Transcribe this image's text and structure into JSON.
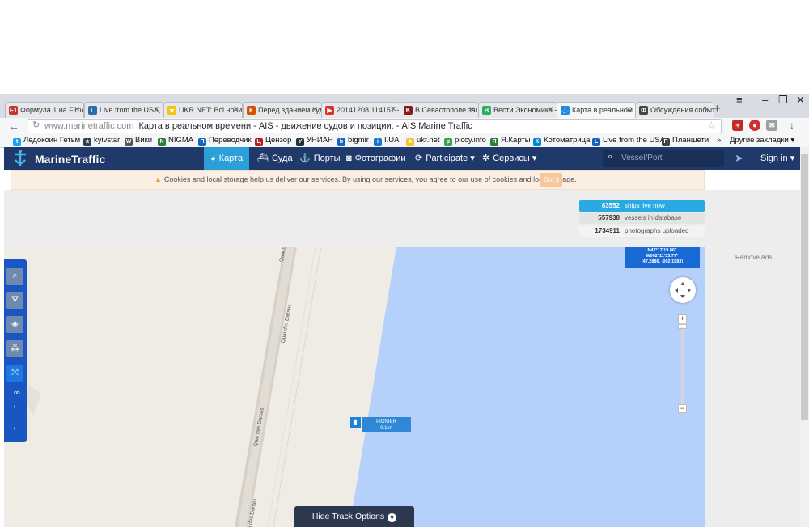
{
  "browser": {
    "tabs": [
      {
        "label": "Формула 1 на F1ne",
        "color": "#c0392b",
        "glyph": "F1"
      },
      {
        "label": "Live from the USA, ·",
        "color": "#2b6cb0",
        "glyph": "L"
      },
      {
        "label": "UKR.NET: Всі новин",
        "color": "#f1c40f",
        "glyph": "★"
      },
      {
        "label": "Перед зданием суд",
        "color": "#d35400",
        "glyph": "К"
      },
      {
        "label": "20141208 114157 - Y",
        "color": "#e52d27",
        "glyph": "▶"
      },
      {
        "label": "В Севастополе зац",
        "color": "#8b1a1a",
        "glyph": "K"
      },
      {
        "label": "Вести Экономика -",
        "color": "#27ae60",
        "glyph": "В"
      },
      {
        "label": "Карта в реальном в",
        "color": "#1e88e5",
        "glyph": "⚓"
      },
      {
        "label": "Обсуждения событ",
        "color": "#444444",
        "glyph": "Ф"
      }
    ],
    "new_tab": "+",
    "window": {
      "minimize": "–",
      "restore": "❐",
      "close": "✕",
      "menu": "≡"
    },
    "address": {
      "host": "www.marinetraffic.com",
      "title": "Карта в реальном времени - AIS - движение судов и позиции. - AIS Marine Traffic"
    },
    "bookmarks": [
      {
        "label": "Ледокоин Гетьм",
        "color": "#1da1f2",
        "glyph": "t"
      },
      {
        "label": "kyivstar",
        "color": "#2c3e50",
        "glyph": "★"
      },
      {
        "label": "Вики",
        "color": "#555555",
        "glyph": "W"
      },
      {
        "label": "NIGMA",
        "color": "#2e7d32",
        "glyph": "N"
      },
      {
        "label": "Переводчик",
        "color": "#1565c0",
        "glyph": "П"
      },
      {
        "label": "Цензор",
        "color": "#b71c1c",
        "glyph": "Ц"
      },
      {
        "label": "УНИАН",
        "color": "#263238",
        "glyph": "У"
      },
      {
        "label": "bigmir",
        "color": "#1565c0",
        "glyph": "b"
      },
      {
        "label": "I.UA",
        "color": "#1976d2",
        "glyph": "i"
      },
      {
        "label": "ukr.net",
        "color": "#fbc02d",
        "glyph": "★"
      },
      {
        "label": "piccy.info",
        "color": "#43a047",
        "glyph": "p"
      },
      {
        "label": "Я.Карты",
        "color": "#2e7d32",
        "glyph": "Я"
      },
      {
        "label": "Котоматрица",
        "color": "#0288d1",
        "glyph": "К"
      },
      {
        "label": "Live from the USA",
        "color": "#1565c0",
        "glyph": "L"
      },
      {
        "label": "Планшети",
        "color": "#424242",
        "glyph": "П"
      }
    ],
    "bookmarks_more": "»",
    "other_bookmarks": "Другие закладки ▾"
  },
  "header": {
    "brand": "MarineTraffic",
    "nav": [
      "Карта",
      "Суда",
      "Порты",
      "Фотографии",
      "Participate ▾",
      "Сервисы ▾"
    ],
    "search_placeholder": "Vessel/Port",
    "signin": "Sign in ▾"
  },
  "cookie": {
    "text": "Cookies and local storage help us deliver our services. By using our services, you agree to",
    "link": "our use of cookies and local storage",
    "end": ".",
    "button": "Got it"
  },
  "stats": [
    {
      "value": "63552",
      "label": "ships live now"
    },
    {
      "value": "557938",
      "label": "vessels in database"
    },
    {
      "value": "1734911",
      "label": "photographs uploaded"
    }
  ],
  "remove_ads": "Remove Ads",
  "map": {
    "coords": [
      "N47°17'19.86\"",
      "W002°11'33.77\"",
      "(47.2886, -002.1983)"
    ],
    "road_label": "Quai des Darses",
    "vessel": {
      "name": "PIONIER",
      "distance": "0.1kn"
    },
    "zoom_in": "+",
    "zoom_out": "−",
    "infinity": "∞",
    "hide_track": "Hide Track Options"
  },
  "colors": {
    "nav_bg": "#20396b",
    "nav_active": "#2a9fd8",
    "sea": "#b5d0fa",
    "land": "#efece6",
    "stat_highlight": "#2aaae2"
  }
}
